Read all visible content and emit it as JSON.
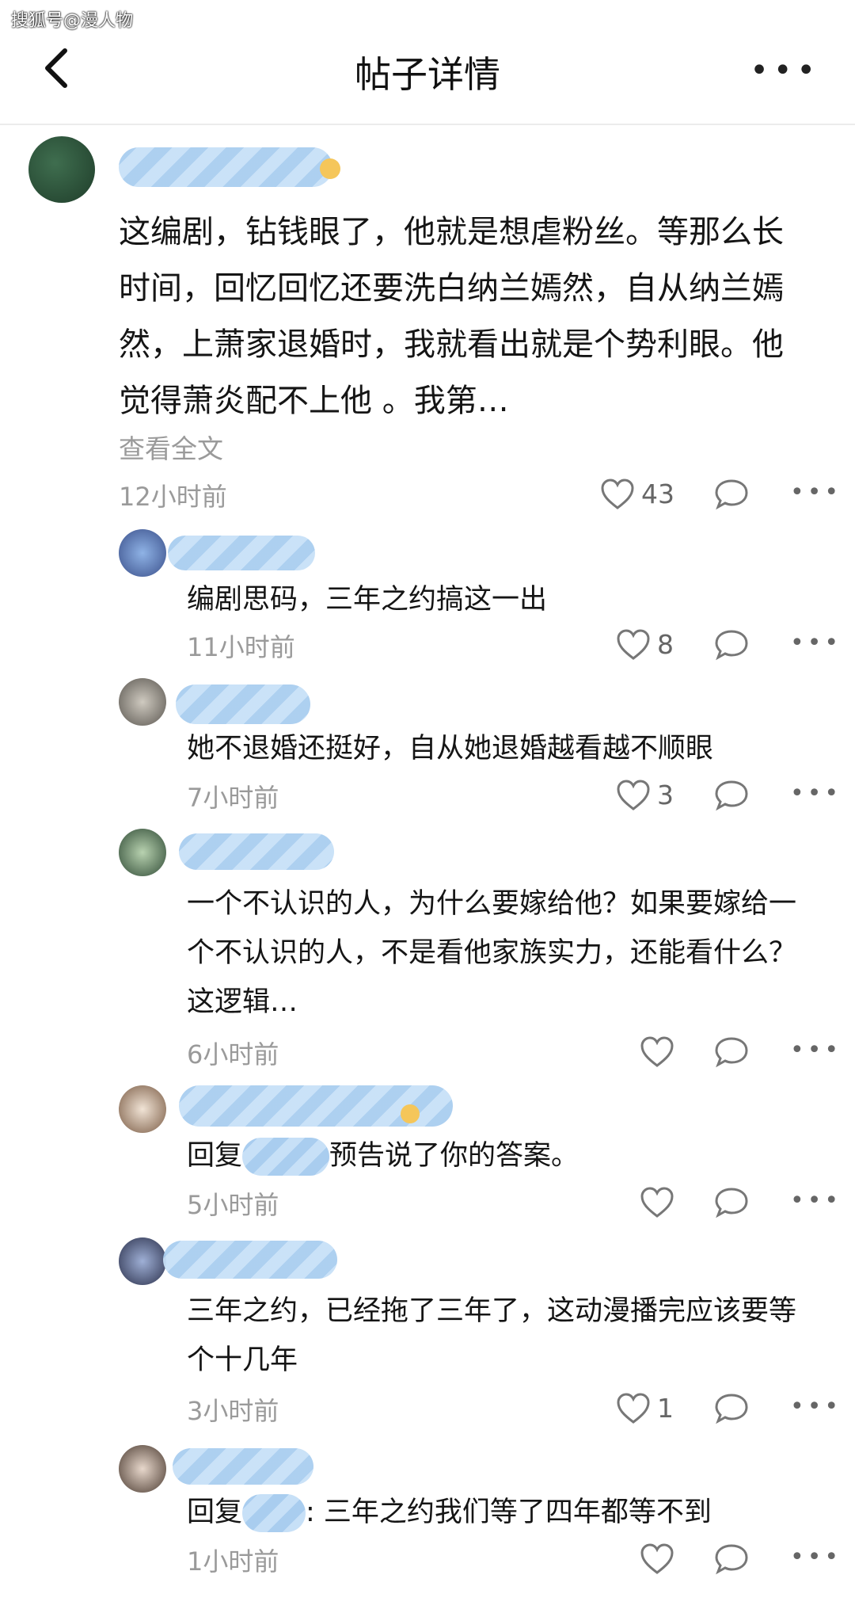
{
  "watermark": "搜狐号@漫人物",
  "header": {
    "title": "帖子详情"
  },
  "post": {
    "text": "这编剧，钻钱眼了，他就是想虐粉丝。等那么长时间，回忆回忆还要洗白纳兰嫣然，自从纳兰嫣然，上萧家退婚时，我就看出就是个势利眼。他觉得萧炎配不上他 。我第…",
    "expand": "查看全文",
    "time": "12小时前",
    "likes": "43"
  },
  "replies": [
    {
      "text": "编剧思码，三年之约搞这一出",
      "time": "11小时前",
      "likes": "8"
    },
    {
      "text": "她不退婚还挺好，自从她退婚越看越不顺眼",
      "time": "7小时前",
      "likes": "3"
    },
    {
      "text": "一个不认识的人，为什么要嫁给他？如果要嫁给一个不认识的人，不是看他家族实力，还能看什么？这逻辑…",
      "time": "6小时前",
      "likes": ""
    },
    {
      "prefix": "回复",
      "text": "预告说了你的答案。",
      "time": "5小时前",
      "likes": ""
    },
    {
      "text": "三年之约，已经拖了三年了，这动漫播完应该要等个十几年",
      "time": "3小时前",
      "likes": "1"
    },
    {
      "prefix": "回复",
      "text": ": 三年之约我们等了四年都等不到",
      "time": "1小时前",
      "likes": ""
    }
  ],
  "icons": {
    "back": "chevron-left-icon",
    "more": "more-dots-icon",
    "like": "heart-icon",
    "comment": "comment-bubble-icon"
  },
  "colors": {
    "blur": "#a9cdef",
    "muted": "#9a9a9a",
    "text": "#151515"
  }
}
